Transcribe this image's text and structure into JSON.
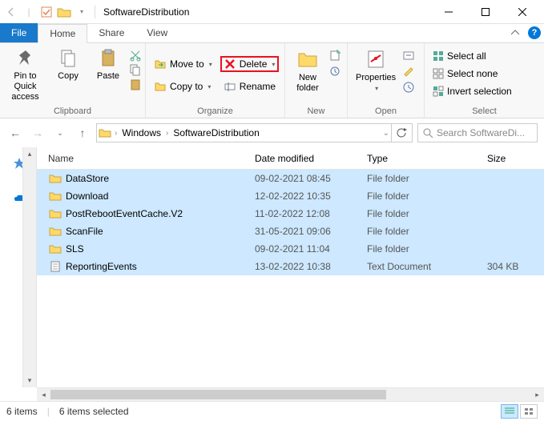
{
  "window": {
    "title": "SoftwareDistribution"
  },
  "tabs": {
    "file": "File",
    "home": "Home",
    "share": "Share",
    "view": "View"
  },
  "ribbon": {
    "clipboard": {
      "label": "Clipboard",
      "pin": "Pin to Quick\naccess",
      "copy": "Copy",
      "paste": "Paste"
    },
    "organize": {
      "label": "Organize",
      "moveto": "Move to",
      "copyto": "Copy to",
      "delete": "Delete",
      "rename": "Rename"
    },
    "new": {
      "label": "New",
      "newfolder": "New\nfolder"
    },
    "open": {
      "label": "Open",
      "properties": "Properties"
    },
    "select": {
      "label": "Select",
      "all": "Select all",
      "none": "Select none",
      "invert": "Invert selection"
    }
  },
  "breadcrumb": {
    "root": "Windows",
    "current": "SoftwareDistribution"
  },
  "search": {
    "placeholder": "Search SoftwareDi..."
  },
  "columns": {
    "name": "Name",
    "date": "Date modified",
    "type": "Type",
    "size": "Size"
  },
  "rows": [
    {
      "icon": "folder",
      "name": "DataStore",
      "date": "09-02-2021 08:45",
      "type": "File folder",
      "size": "",
      "selected": true
    },
    {
      "icon": "folder",
      "name": "Download",
      "date": "12-02-2022 10:35",
      "type": "File folder",
      "size": "",
      "selected": true
    },
    {
      "icon": "folder",
      "name": "PostRebootEventCache.V2",
      "date": "11-02-2022 12:08",
      "type": "File folder",
      "size": "",
      "selected": true
    },
    {
      "icon": "folder",
      "name": "ScanFile",
      "date": "31-05-2021 09:06",
      "type": "File folder",
      "size": "",
      "selected": true
    },
    {
      "icon": "folder",
      "name": "SLS",
      "date": "09-02-2021 11:04",
      "type": "File folder",
      "size": "",
      "selected": true
    },
    {
      "icon": "text",
      "name": "ReportingEvents",
      "date": "13-02-2022 10:38",
      "type": "Text Document",
      "size": "304 KB",
      "selected": true
    }
  ],
  "status": {
    "items": "6 items",
    "selected": "6 items selected"
  }
}
